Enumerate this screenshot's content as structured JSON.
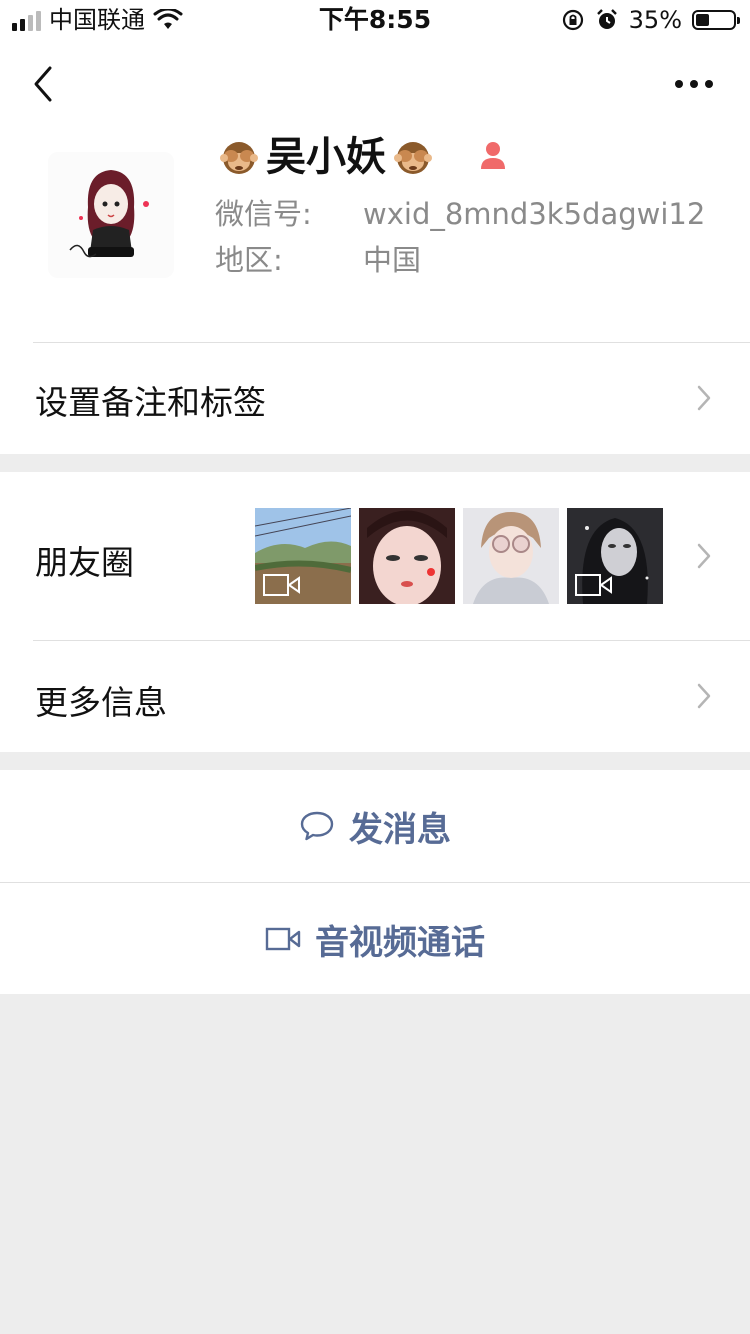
{
  "status_bar": {
    "carrier": "中国联通",
    "time": "下午8:55",
    "battery_percent": "35%",
    "battery_level": 0.35
  },
  "profile": {
    "name": "吴小妖",
    "name_emoji": "see-no-evil-monkey",
    "gender": "female",
    "wxid_label": "微信号:",
    "wxid_value": "wxid_8mnd3k5dagwi12",
    "region_label": "地区:",
    "region_value": "中国"
  },
  "cells": {
    "remark": "设置备注和标签",
    "moments": "朋友圈",
    "more_info": "更多信息"
  },
  "moments_thumbs": [
    {
      "kind": "video",
      "scene": "landscape"
    },
    {
      "kind": "photo",
      "scene": "portrait"
    },
    {
      "kind": "photo",
      "scene": "portrait"
    },
    {
      "kind": "video",
      "scene": "portrait"
    }
  ],
  "actions": {
    "message": "发消息",
    "call": "音视频通话"
  },
  "colors": {
    "link": "#576b95",
    "background": "#ededed",
    "female_icon": "#f06a6a"
  }
}
